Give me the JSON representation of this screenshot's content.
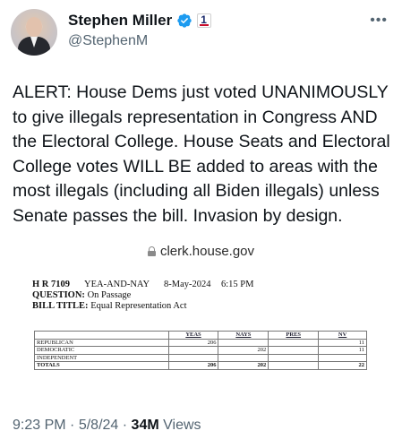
{
  "author": {
    "name": "Stephen Miller",
    "handle": "@StephenM",
    "badge_number": "1"
  },
  "tweet": {
    "lines": [
      "ALERT: House Dems just voted UNANIMOUSLY",
      "to give illegals representation in Congress AND",
      "the Electoral College. House Seats and Electoral",
      "College votes WILL BE added to areas with the",
      "most illegals (including all Biden illegals) unless",
      "Senate passes the bill. Invasion by design."
    ]
  },
  "link": {
    "domain": "clerk.house.gov"
  },
  "document": {
    "bill": "H R 7109",
    "vote_type": "YEA-AND-NAY",
    "date": "8-May-2024",
    "time": "6:15 PM",
    "question_label": "QUESTION:",
    "question": "On Passage",
    "title_label": "BILL TITLE:",
    "title": "Equal Representation Act",
    "table": {
      "headers": [
        "",
        "YEAS",
        "NAYS",
        "PRES",
        "NV"
      ],
      "rows": [
        [
          "REPUBLICAN",
          "206",
          "",
          "",
          "11"
        ],
        [
          "DEMOCRATIC",
          "",
          "202",
          "",
          "11"
        ],
        [
          "INDEPENDENT",
          "",
          "",
          "",
          ""
        ],
        [
          "TOTALS",
          "206",
          "202",
          "",
          "22"
        ]
      ]
    }
  },
  "footer": {
    "time": "9:23 PM",
    "separator": "·",
    "date": "5/8/24",
    "views_count": "34M",
    "views_label": "Views"
  },
  "colors": {
    "text": "#0f1419",
    "muted": "#536471",
    "verified": "#1d9bf0"
  }
}
